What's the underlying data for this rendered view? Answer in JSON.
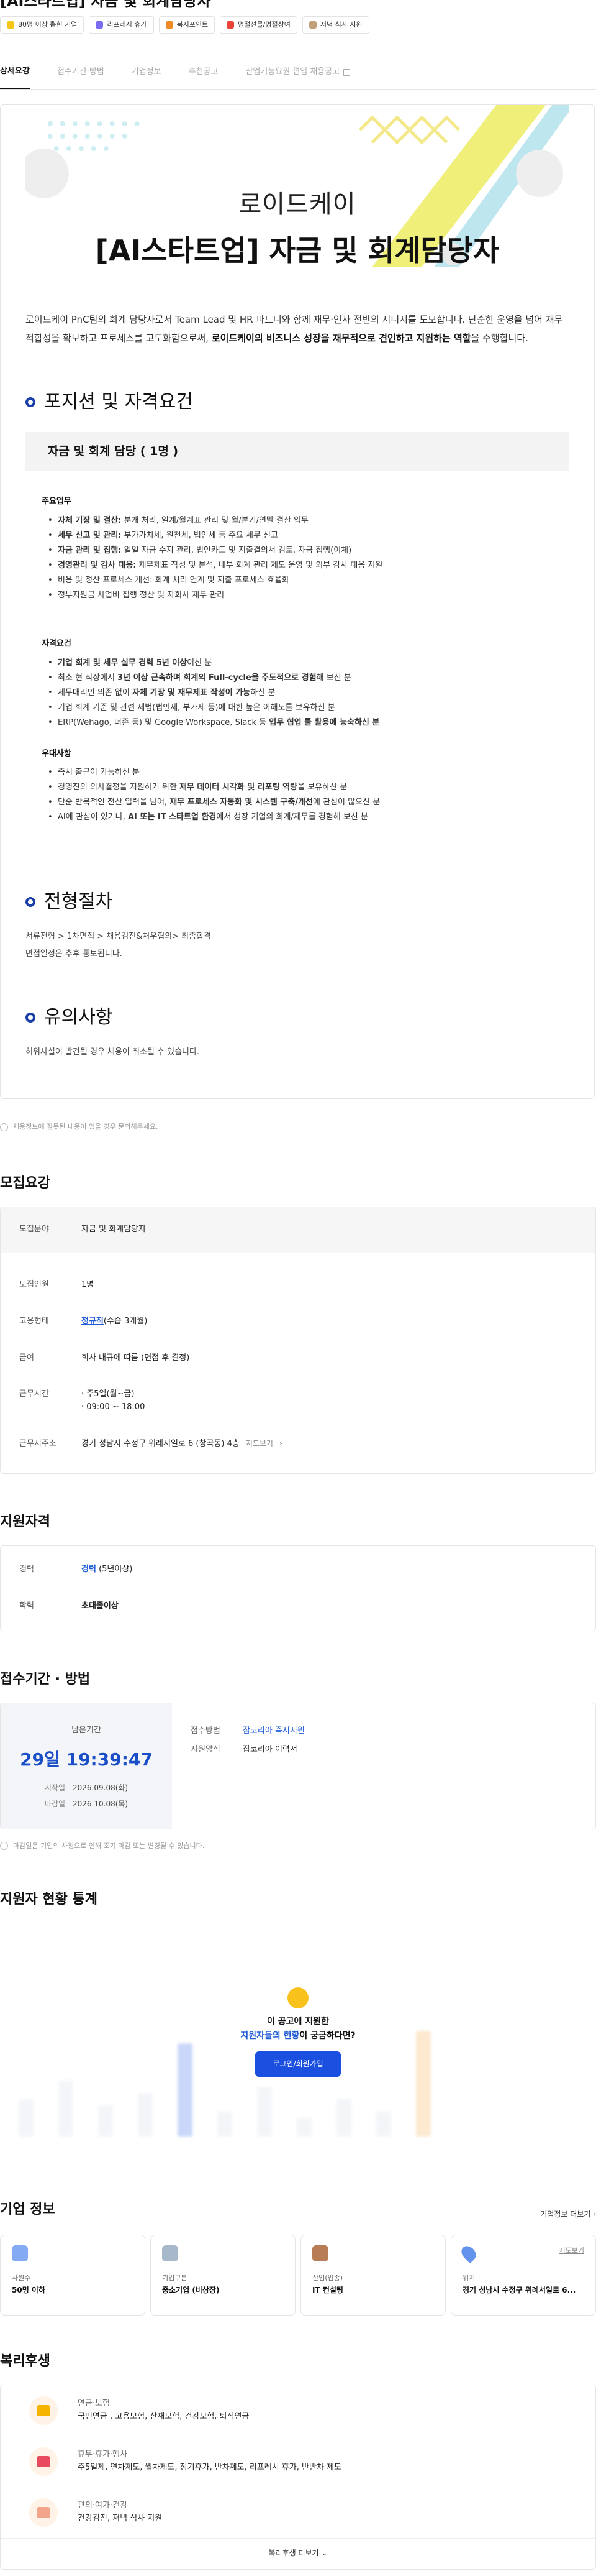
{
  "header": {
    "job_title": "[AI스타트업] 자금 및 회계담당자",
    "badges": [
      {
        "label": "80명 이상 뽑힌 기업",
        "color": "#f5c518"
      },
      {
        "label": "리프레시 휴가",
        "color": "#7a6cf0"
      },
      {
        "label": "복지포인트",
        "color": "#f08a24"
      },
      {
        "label": "명절선물/명절상여",
        "color": "#e8443a"
      },
      {
        "label": "저녁 식사 지원",
        "color": "#c2a07a"
      }
    ]
  },
  "tabs": [
    {
      "label": "상세요강",
      "active": true
    },
    {
      "label": "접수기간·방법",
      "active": false
    },
    {
      "label": "기업정보",
      "active": false
    },
    {
      "label": "추천공고",
      "active": false
    },
    {
      "label": "산업기능요원 편입 채용공고",
      "active": false
    }
  ],
  "detail": {
    "company": "로이드케이",
    "title": "[AI스타트업] 자금 및 회계담당자",
    "intro_plain": "로이드케이 PnC팀의 회계 담당자로서 Team Lead 및 HR 파트너와 함께 재무·인사 전반의 시너지를 도모합니다. 단순한 운영을 넘어 재무 적합성을 확보하고 프로세스를 고도화함으로써, ",
    "intro_bold": "로이드케이의 비즈니스 성장을 재무적으로 견인하고 지원하는 역할",
    "intro_tail": "을 수행합니다.",
    "section_position": "포지션 및 자격요건",
    "role": "자금 및 회계 담당 ( 1명 )",
    "duties_title": "주요업무",
    "duties": [
      {
        "b": "자체 기장 및 결산:",
        "t": " 분개 처리, 일계/월계표 관리 및 월/분기/연말 결산 업무"
      },
      {
        "b": "세무 신고 및 관리:",
        "t": " 부가가치세, 원천세, 법인세 등 주요 세무 신고"
      },
      {
        "b": "자금 관리 및 집행:",
        "t": " 일일 자금 수지 관리, 법인카드 및 지출결의서 검토, 자금 집행(이체)"
      },
      {
        "b": "경영관리 및 감사 대응:",
        "t": " 재무제표 작성 및 분석, 내부 회계 관리 제도 운영 및 외부 감사 대응 지원"
      },
      {
        "b": "",
        "t": "비용 및 정산 프로세스 개선: 회계 처리 연계 및 지출 프로세스 효율화"
      },
      {
        "b": "",
        "t": "정부지원금 사업비 집행 정산 및 자회사 재무 관리"
      }
    ],
    "quals_title": "자격요건",
    "quals": [
      {
        "b": "기업 회계 및 세무 실무 경력 5년 이상",
        "t": "이신 분",
        "mid": ""
      },
      {
        "b": "",
        "t": "최소 현 직장에서 ",
        "mid": "3년 이상 근속하며 회계의 Full-cycle을 주도적으로 경험",
        "tail": "해 보신 분"
      },
      {
        "b": "",
        "t": "세무대리인 의존 없이 ",
        "mid": "자체 기장 및 재무제표 작성이 가능",
        "tail": "하신 분"
      },
      {
        "b": "",
        "t": "기업 회계 기준 및 관련 세법(법인세, 부가세 등)에 대한 높은 이해도를 보유하신 분",
        "mid": "",
        "tail": ""
      },
      {
        "b": "",
        "t": "ERP(Wehago, 더존 등) 및 Google Workspace, Slack 등 ",
        "mid": "업무 협업 툴 활용에 능숙하신 분",
        "tail": ""
      }
    ],
    "prefs_title": "우대사항",
    "prefs": [
      {
        "t": "즉시 출근이 가능하신 분",
        "mid": "",
        "tail": ""
      },
      {
        "t": "경영진의 의사결정을 지원하기 위한 ",
        "mid": "재무 데이터 시각화 및 리포팅 역량",
        "tail": "을 보유하신 분"
      },
      {
        "t": "단순 반복적인 전산 입력을 넘어, ",
        "mid": "재무 프로세스 자동화 및 시스템 구축/개선",
        "tail": "에 관심이 많으신 분"
      },
      {
        "t": "AI에 관심이 있거나, ",
        "mid": "AI 또는 IT 스타트업 환경",
        "tail": "에서 성장 기업의 회계/재무를 경험해 보신 분"
      }
    ],
    "section_process": "전형절차",
    "process_lines": [
      "서류전형 > 1차면접 > 채용검진&처우협의> 최종합격",
      "면접일정은 추후 통보됩니다."
    ],
    "section_notice": "유의사항",
    "notice_lines": [
      "허위사실이 발견될 경우 채용이 취소될 수 있습니다."
    ]
  },
  "disclaimer": "채용정보에 잘못된 내용이 있을 경우 문의해주세요.",
  "recruit": {
    "heading": "모집요강",
    "rows": [
      {
        "k": "모집분야",
        "v": "자금 및 회계담당자"
      },
      {
        "k": "모집인원",
        "v": "1명"
      },
      {
        "k": "고용형태",
        "v": "정규직",
        "v2": "(수습 3개월)"
      },
      {
        "k": "급여",
        "v": "회사 내규에 따름 (면접 후 결정)"
      },
      {
        "k": "근무시간",
        "v": "· 주5일(월~금)",
        "v2": "· 09:00 ~ 18:00"
      },
      {
        "k": "근무지주소",
        "v": "경기 성남시 수정구 위례서일로 6 (창곡동) 4층",
        "link": "지도보기"
      }
    ]
  },
  "qualification": {
    "heading": "지원자격",
    "rows": [
      {
        "k": "경력",
        "v": "경력",
        "v2": "(5년이상)"
      },
      {
        "k": "학력",
        "v": "초대졸이상"
      }
    ]
  },
  "apply": {
    "heading": "접수기간 · 방법",
    "remain_label": "남은기간",
    "remain": "29일 19:39:47",
    "start_label": "시작일",
    "start": "2026.09.08(화)",
    "end_label": "마감일",
    "end": "2026.10.08(목)",
    "method_label": "접수방법",
    "method": "잡코리아 즉시지원",
    "form_label": "지원양식",
    "form": "잡코리아 이력서",
    "notice": "마감일은 기업의 사정으로 인해 조기 마감 또는 변경될 수 있습니다."
  },
  "stats": {
    "heading": "지원자 현황 통계",
    "q1": "이 공고에 지원한",
    "q2_blue": "지원자들의 현황",
    "q2_tail": "이 궁금하다면?",
    "button": "로그인/회원가입"
  },
  "company": {
    "heading": "기업 정보",
    "more": "기업정보 더보기",
    "cards": [
      {
        "label": "사원수",
        "value": "50명 이하",
        "color": "#5b8def"
      },
      {
        "label": "기업구분",
        "value": "중소기업 (비상장)",
        "color": "#8aa0b8"
      },
      {
        "label": "산업(업종)",
        "value": "IT 컨설팅",
        "color": "#a0521d"
      },
      {
        "label": "위치",
        "value": "경기 성남시 수정구 위례서일로 6...",
        "color": "#2f6fe4",
        "link": "지도보기"
      }
    ]
  },
  "welfare": {
    "heading": "복리후생",
    "items": [
      {
        "title": "연금·보험",
        "desc": "국민연금 , 고용보험, 산재보험, 건강보험, 퇴직연금",
        "color": "#f4b400"
      },
      {
        "title": "휴무·휴가·행사",
        "desc": "주5일제, 연차제도, 월차제도, 정기휴가, 반차제도, 리프레시 휴가, 반반차 제도",
        "color": "#e84a5f"
      },
      {
        "title": "편의·여가·건강",
        "desc": "건강검진, 저녁 식사 지원",
        "color": "#f2a58a"
      }
    ],
    "more": "복리후생 더보기"
  }
}
